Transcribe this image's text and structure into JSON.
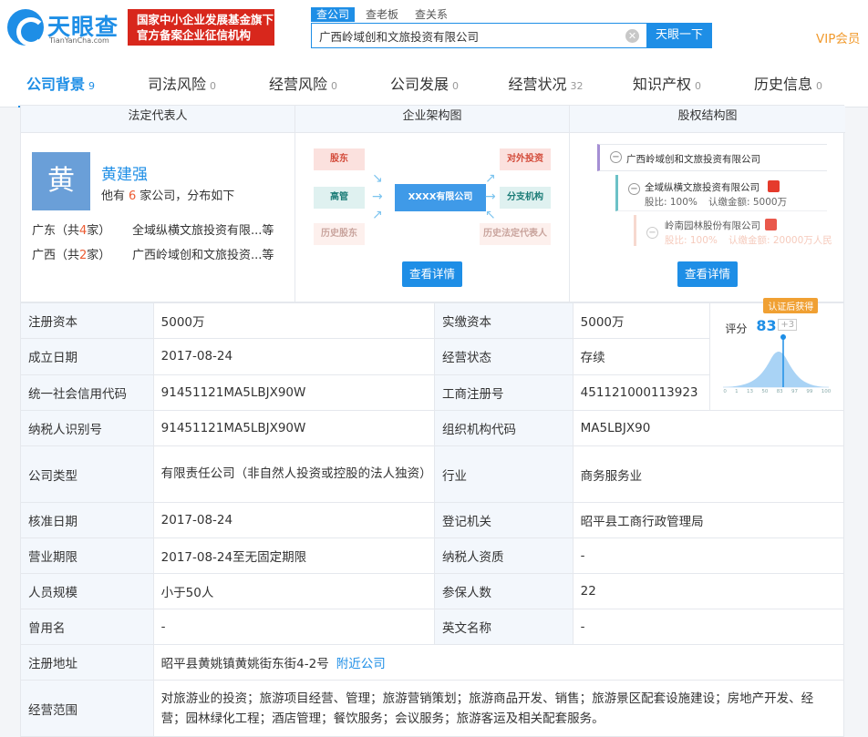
{
  "header": {
    "logo_name": "天眼查",
    "logo_sub": "TianYanCha.com",
    "banner_line1": "国家中小企业发展基金旗下",
    "banner_line2": "官方备案企业征信机构",
    "search_tabs": [
      "查公司",
      "查老板",
      "查关系"
    ],
    "search_value": "广西岭域创和文旅投资有限公司",
    "search_button": "天眼一下",
    "vip": "VIP会员"
  },
  "nav": [
    {
      "label": "公司背景",
      "count": "9"
    },
    {
      "label": "司法风险",
      "count": "0"
    },
    {
      "label": "经营风险",
      "count": "0"
    },
    {
      "label": "公司发展",
      "count": "0"
    },
    {
      "label": "经营状况",
      "count": "32"
    },
    {
      "label": "知识产权",
      "count": "0"
    },
    {
      "label": "历史信息",
      "count": "0"
    }
  ],
  "legal": {
    "head": "法定代表人",
    "avatar": "黄",
    "name": "黄建强",
    "sub_pre": "他有",
    "sub_num": "6",
    "sub_post": "家公司，分布如下",
    "provinces": [
      {
        "prov": "广东（共",
        "n": "4",
        "suf": "家）",
        "company": "全域纵横文旅投资有限...等"
      },
      {
        "prov": "广西（共",
        "n": "2",
        "suf": "家）",
        "company": "广西岭域创和文旅投资...等"
      }
    ]
  },
  "structure": {
    "head": "企业架构图",
    "nodes": {
      "shareholder": "股东",
      "exec": "高管",
      "center": "XXXX有限公司",
      "invest": "对外投资",
      "branch": "分支机构",
      "hist_share": "历史股东",
      "hist_rep": "历史法定代表人"
    },
    "button": "查看详情"
  },
  "equity": {
    "head": "股权结构图",
    "root": "广西岭域创和文旅投资有限公司",
    "c1_name": "全域纵横文旅投资有限公司",
    "c1_ratio": "股比: 100%",
    "c1_amount": "认缴金额: 5000万",
    "c2_name": "岭南园林股份有限公司",
    "c2_ratio": "股比: 100%",
    "c2_amount": "认缴金额: 20000万人民",
    "button": "查看详情"
  },
  "info": {
    "reg_capital_label": "注册资本",
    "reg_capital": "5000万",
    "paid_capital_label": "实缴资本",
    "paid_capital": "5000万",
    "founded_label": "成立日期",
    "founded": "2017-08-24",
    "status_label": "经营状态",
    "status": "存续",
    "credit_code_label": "统一社会信用代码",
    "credit_code": "91451121MA5LBJX90W",
    "biz_reg_label": "工商注册号",
    "biz_reg": "451121000113923",
    "taxpayer_id_label": "纳税人识别号",
    "taxpayer_id": "91451121MA5LBJX90W",
    "org_code_label": "组织机构代码",
    "org_code": "MA5LBJX90",
    "type_label": "公司类型",
    "type": "有限责任公司（非自然人投资或控股的法人独资）",
    "industry_label": "行业",
    "industry": "商务服务业",
    "approved_label": "核准日期",
    "approved": "2017-08-24",
    "authority_label": "登记机关",
    "authority": "昭平县工商行政管理局",
    "term_label": "营业期限",
    "term": "2017-08-24至无固定期限",
    "tax_qual_label": "纳税人资质",
    "tax_qual": "-",
    "staff_label": "人员规模",
    "staff": "小于50人",
    "insured_label": "参保人数",
    "insured": "22",
    "former_label": "曾用名",
    "former": "-",
    "english_label": "英文名称",
    "english": "-",
    "address_label": "注册地址",
    "address": "昭平县黄姚镇黄姚街东街4-2号",
    "address_link": "附近公司",
    "scope_label": "经营范围",
    "scope": "对旅游业的投资；旅游项目经营、管理；旅游营销策划；旅游商品开发、销售；旅游景区配套设施建设；房地产开发、经营；园林绿化工程；酒店管理；餐饮服务；会议服务；旅游客运及相关配套服务。"
  },
  "score": {
    "badge": "认证后获得",
    "label": "评分",
    "value": "83",
    "plus": "+3",
    "ticks": [
      "0",
      "1",
      "13",
      "50",
      "83",
      "97",
      "99",
      "100"
    ]
  }
}
